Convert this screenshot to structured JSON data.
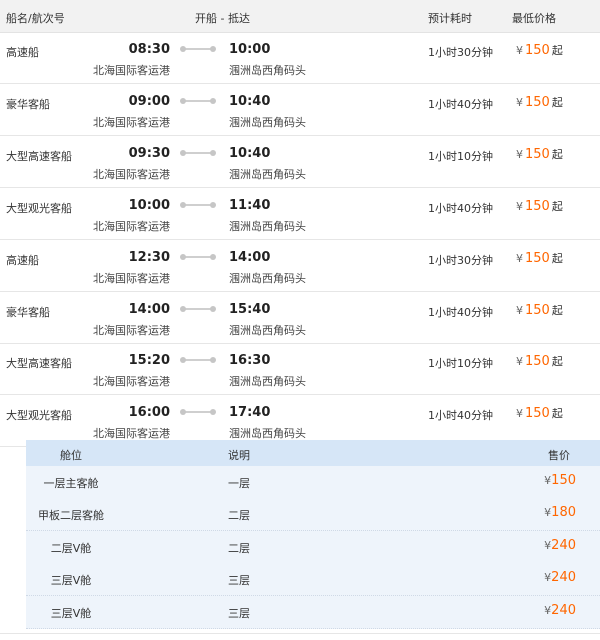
{
  "header": {
    "col_ship": "船名/航次号",
    "col_time": "开船 - 抵达",
    "col_duration": "预计耗时",
    "col_price": "最低价格"
  },
  "rows": [
    {
      "ship": "高速船",
      "depart_time": "08:30",
      "depart_port": "北海国际客运港",
      "arrive_time": "10:00",
      "arrive_port": "涠洲岛西角码头",
      "duration": "1小时30分钟",
      "price": "150"
    },
    {
      "ship": "豪华客船",
      "depart_time": "09:00",
      "depart_port": "北海国际客运港",
      "arrive_time": "10:40",
      "arrive_port": "涠洲岛西角码头",
      "duration": "1小时40分钟",
      "price": "150"
    },
    {
      "ship": "大型高速客船",
      "depart_time": "09:30",
      "depart_port": "北海国际客运港",
      "arrive_time": "10:40",
      "arrive_port": "涠洲岛西角码头",
      "duration": "1小时10分钟",
      "price": "150"
    },
    {
      "ship": "大型观光客船",
      "depart_time": "10:00",
      "depart_port": "北海国际客运港",
      "arrive_time": "11:40",
      "arrive_port": "涠洲岛西角码头",
      "duration": "1小时40分钟",
      "price": "150"
    },
    {
      "ship": "高速船",
      "depart_time": "12:30",
      "depart_port": "北海国际客运港",
      "arrive_time": "14:00",
      "arrive_port": "涠洲岛西角码头",
      "duration": "1小时30分钟",
      "price": "150"
    },
    {
      "ship": "豪华客船",
      "depart_time": "14:00",
      "depart_port": "北海国际客运港",
      "arrive_time": "15:40",
      "arrive_port": "涠洲岛西角码头",
      "duration": "1小时40分钟",
      "price": "150"
    },
    {
      "ship": "大型高速客船",
      "depart_time": "15:20",
      "depart_port": "北海国际客运港",
      "arrive_time": "16:30",
      "arrive_port": "涠洲岛西角码头",
      "duration": "1小时10分钟",
      "price": "150"
    },
    {
      "ship": "大型观光客船",
      "depart_time": "16:00",
      "depart_port": "北海国际客运港",
      "arrive_time": "17:40",
      "arrive_port": "涠洲岛西角码头",
      "duration": "1小时40分钟",
      "price": "150"
    }
  ],
  "currency": "¥",
  "price_suffix": "起",
  "seat_table": {
    "col_cabin": "舱位",
    "col_desc": "说明",
    "col_price": "售价",
    "rows": [
      {
        "cabin": "一层主客舱",
        "desc": "一层",
        "price": "150"
      },
      {
        "cabin": "甲板二层客舱",
        "desc": "二层",
        "price": "180"
      },
      {
        "cabin": "二层V舱",
        "desc": "二层",
        "price": "240"
      },
      {
        "cabin": "三层V舱",
        "desc": "三层",
        "price": "240"
      },
      {
        "cabin": "三层V舱",
        "desc": "三层",
        "price": "240"
      }
    ]
  },
  "colors": {
    "accent": "#ff6600",
    "header_bg": "#f2f2f2",
    "sub_header_bg": "#d6e6f7",
    "sub_row_bg": "#eef4fb"
  }
}
